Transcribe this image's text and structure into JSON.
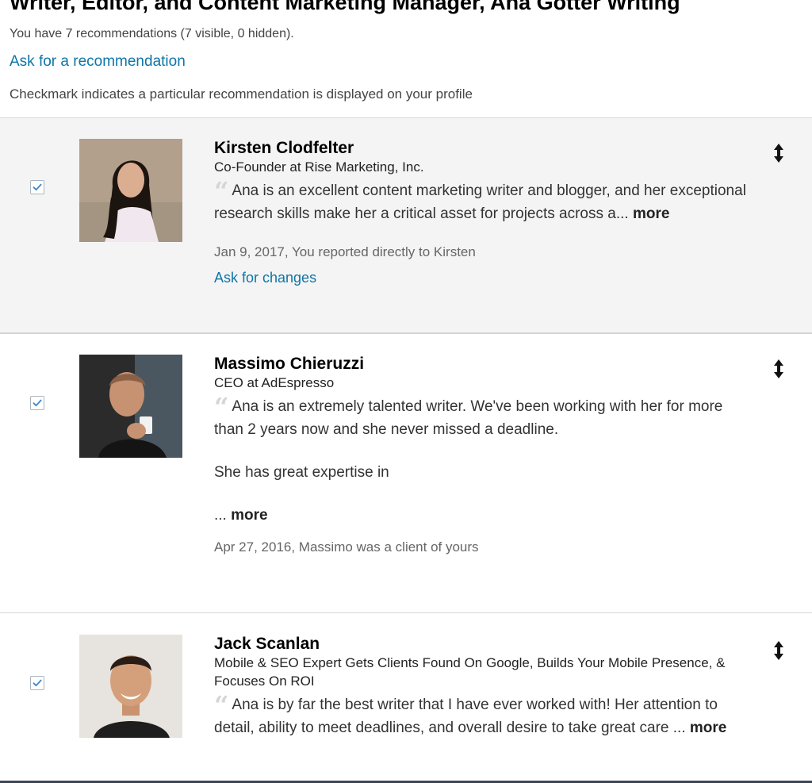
{
  "header": {
    "title": "Writer, Editor, and Content Marketing Manager, Ana Gotter Writing",
    "count_text": "You have 7 recommendations (7 visible, 0 hidden).",
    "ask_link": "Ask for a recommendation",
    "hint": "Checkmark indicates a particular recommendation is displayed on your profile"
  },
  "recommendations": [
    {
      "checked": true,
      "name": "Kirsten Clodfelter",
      "headline": "Co-Founder at Rise Marketing, Inc.",
      "quote": "Ana is an excellent content marketing writer and blogger, and her exceptional research skills make her a critical asset for projects across a...",
      "more": "more",
      "meta": "Jan 9, 2017, You reported directly to Kirsten",
      "ask_changes": "Ask for changes"
    },
    {
      "checked": true,
      "name": "Massimo Chieruzzi",
      "headline": "CEO at AdEspresso",
      "quote": "Ana is an extremely talented writer. We've been working with her for more than 2 years now and she never missed a deadline.",
      "quote_para2": "She has great expertise in",
      "quote_ellipsis": "...",
      "more": "more",
      "meta": "Apr 27, 2016, Massimo was a client of yours"
    },
    {
      "checked": true,
      "name": "Jack Scanlan",
      "headline": "Mobile & SEO Expert Gets Clients Found On Google, Builds Your Mobile Presence, & Focuses On ROI",
      "quote": "Ana is by far the best writer that I have ever worked with! Her attention to detail, ability to meet deadlines, and overall desire to take great care ...",
      "more": "more"
    }
  ],
  "colors": {
    "link": "#0e76a8",
    "selected_row_bg": "#f4f4f4",
    "checkmark": "#3d85c6"
  },
  "icons": {
    "checkbox": "checkmark-icon",
    "drag": "vertical-arrows-icon",
    "quote": "quote-mark-icon"
  }
}
